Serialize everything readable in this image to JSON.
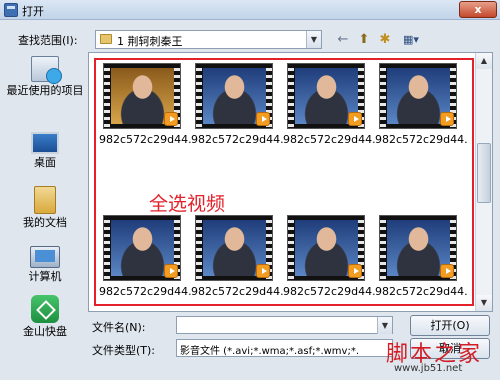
{
  "window": {
    "title": "打开",
    "close_label": "x"
  },
  "toolbar": {
    "lookin_label": "查找范围(I):",
    "lookin_value": "1 荆轲刺秦王",
    "back_glyph": "←",
    "up_glyph": "⬆",
    "newfolder_glyph": "✱",
    "view_glyph": "▦▾"
  },
  "places": [
    {
      "label": "最近使用的项目",
      "icon": "recent-items-icon"
    },
    {
      "label": "桌面",
      "icon": "desktop-icon"
    },
    {
      "label": "我的文档",
      "icon": "documents-icon"
    },
    {
      "label": "计算机",
      "icon": "computer-icon"
    },
    {
      "label": "金山快盘",
      "icon": "kingsoft-kuaipan-icon"
    }
  ],
  "files": [
    {
      "name": "982c572c29d44..."
    },
    {
      "name": "982c572c29d44..."
    },
    {
      "name": "982c572c29d44..."
    },
    {
      "name": "982c572c29d44..."
    },
    {
      "name": "982c572c29d44..."
    },
    {
      "name": "982c572c29d44..."
    },
    {
      "name": "982c572c29d44..."
    },
    {
      "name": "982c572c29d44..."
    }
  ],
  "annotation": {
    "text": "全选视频",
    "color": "#e4202a"
  },
  "bottom": {
    "filename_label": "文件名(N):",
    "filename_value": "",
    "filetype_label": "文件类型(T):",
    "filetype_value": "影音文件 (*.avi;*.wma;*.asf;*.wmv;*.",
    "open_label": "打开(O)",
    "cancel_label": "取消"
  },
  "watermark": {
    "text": "脚本之家",
    "url": "www.jb51.net"
  }
}
